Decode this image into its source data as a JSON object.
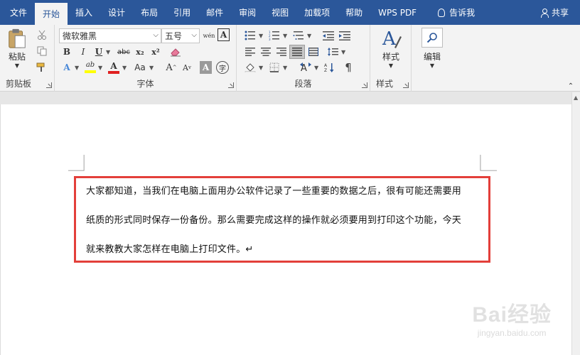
{
  "tabs": [
    "文件",
    "开始",
    "插入",
    "设计",
    "布局",
    "引用",
    "邮件",
    "审阅",
    "视图",
    "加载项",
    "帮助",
    "WPS PDF"
  ],
  "active_tab_index": 1,
  "tell_me": "告诉我",
  "share": "共享",
  "ribbon": {
    "clipboard": {
      "paste_label": "粘贴",
      "group_label": "剪贴板"
    },
    "font": {
      "font_name": "微软雅黑",
      "font_size": "五号",
      "phonetic_glyph": "wén",
      "border_glyph": "A",
      "bold": "B",
      "italic": "I",
      "underline": "U",
      "strike": "abc",
      "subscript": "x₂",
      "superscript": "x²",
      "text_effects": "A",
      "highlight_letter": "ab",
      "font_color_letter": "A",
      "change_case": "Aa",
      "grow": "A",
      "shrink": "A",
      "shading_letter": "A",
      "enclose_char": "字",
      "group_label": "字体"
    },
    "paragraph": {
      "group_label": "段落"
    },
    "styles": {
      "label": "样式",
      "group_label": "样式"
    },
    "editing": {
      "label": "编辑"
    }
  },
  "document": {
    "lines": [
      "大家都知道，当我们在电脑上面用办公软件记录了一些重要的数据之后，很有可能还需要用",
      "纸质的形式同时保存一份备份。那么需要完成这样的操作就必须要用到打印这个功能，今天",
      "就来教教大家怎样在电脑上打印文件。↵"
    ]
  },
  "watermark": {
    "logo": "Bai经验",
    "url": "jingyan.baidu.com"
  },
  "colors": {
    "accent": "#2b579a",
    "highlight_border": "#e33f3a",
    "highlight_yellow": "#ffff00",
    "font_red": "#e02020"
  }
}
